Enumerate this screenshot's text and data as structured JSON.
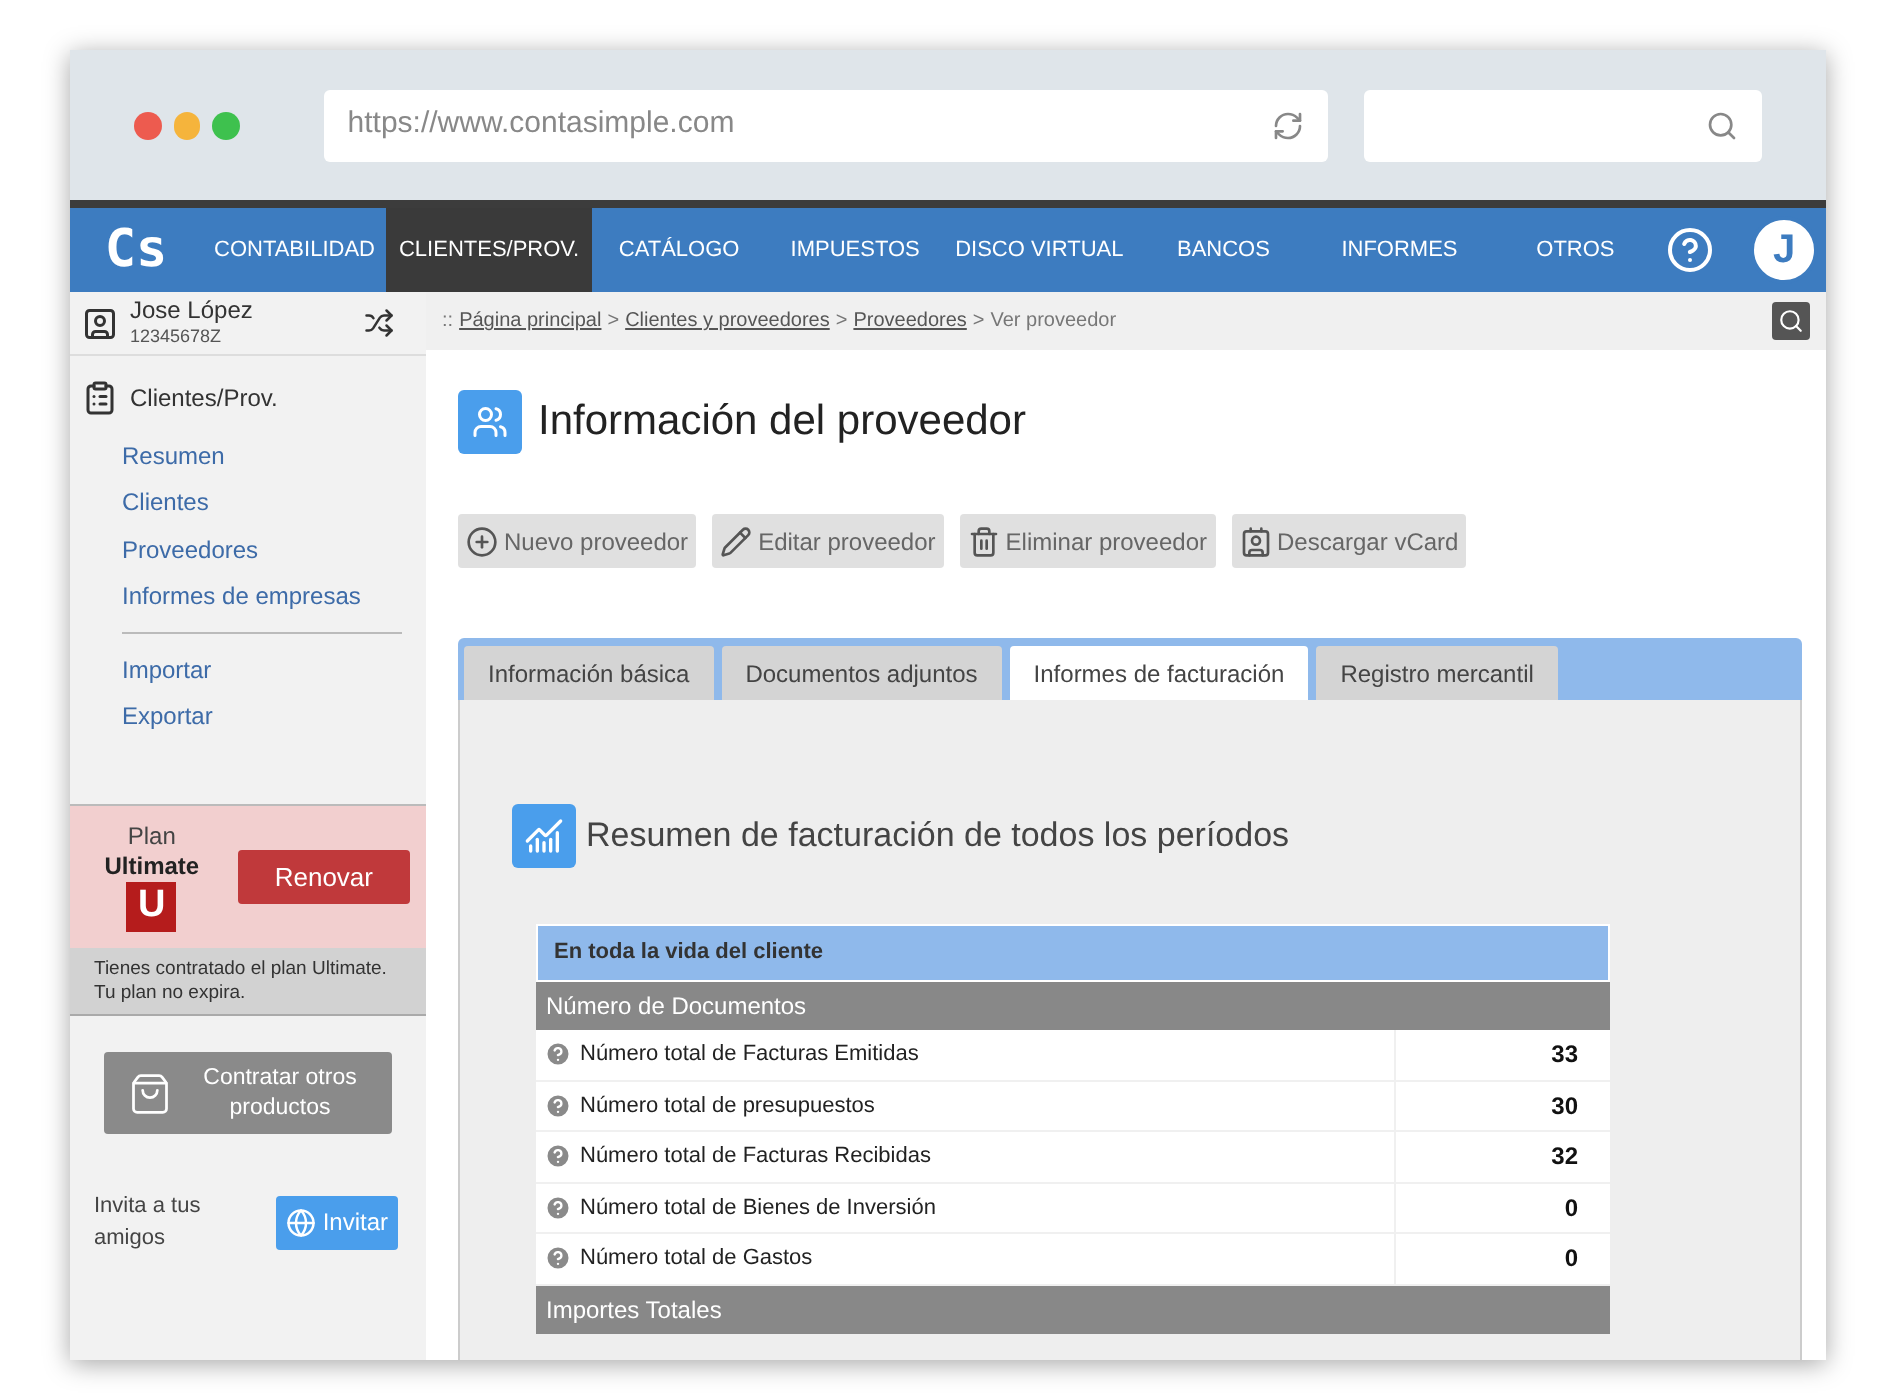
{
  "browser": {
    "url": "https://www.contasimple.com"
  },
  "nav": {
    "logo": "Cs",
    "items": [
      {
        "label": "CONTABILIDAD",
        "selected": false
      },
      {
        "label": "CLIENTES/PROV.",
        "selected": true
      },
      {
        "label": "CATÁLOGO",
        "selected": false
      },
      {
        "label": "IMPUESTOS",
        "selected": false
      },
      {
        "label": "DISCO VIRTUAL",
        "selected": false
      },
      {
        "label": "BANCOS",
        "selected": false
      },
      {
        "label": "INFORMES",
        "selected": false
      },
      {
        "label": "OTROS",
        "selected": false
      }
    ],
    "avatar": "J"
  },
  "user": {
    "name": "Jose López",
    "id": "12345678Z"
  },
  "sidebar": {
    "title": "Clientes/Prov.",
    "groups": [
      [
        {
          "label": "Resumen"
        },
        {
          "label": "Clientes"
        },
        {
          "label": "Proveedores"
        },
        {
          "label": "Informes de empresas"
        }
      ],
      [
        {
          "label": "Importar"
        },
        {
          "label": "Exportar"
        }
      ]
    ]
  },
  "plan": {
    "label": "Plan",
    "name": "Ultimate",
    "badge": "U",
    "button": "Renovar",
    "note": "Tienes contratado el plan Ultimate. Tu plan no expira."
  },
  "products_button": "Contratar otros productos",
  "invite": {
    "text": "Invita a tus amigos",
    "button": "Invitar"
  },
  "breadcrumb": [
    {
      "kind": "prefix",
      "label": "::"
    },
    {
      "kind": "link",
      "label": "Página principal"
    },
    {
      "kind": "separator",
      "label": ">"
    },
    {
      "kind": "link",
      "label": "Clientes y proveedores"
    },
    {
      "kind": "separator",
      "label": ">"
    },
    {
      "kind": "link",
      "label": "Proveedores"
    },
    {
      "kind": "separator",
      "label": ">"
    },
    {
      "kind": "current",
      "label": "Ver proveedor"
    }
  ],
  "page": {
    "title": "Información del proveedor",
    "actions": [
      {
        "label": "Nuevo proveedor"
      },
      {
        "label": "Editar proveedor"
      },
      {
        "label": "Eliminar proveedor"
      },
      {
        "label": "Descargar vCard"
      }
    ],
    "tabs": [
      {
        "label": "Información básica",
        "selected": false
      },
      {
        "label": "Documentos adjuntos",
        "selected": false
      },
      {
        "label": "Informes de facturación",
        "selected": true
      },
      {
        "label": "Registro mercantil",
        "selected": false
      }
    ],
    "section_title": "Resumen de facturación de todos los períodos",
    "table": {
      "header": "En toda la vida del cliente",
      "groups": [
        {
          "title": "Número de Documentos",
          "rows": [
            {
              "label": "Número total de Facturas Emitidas",
              "value": "33"
            },
            {
              "label": "Número total de presupuestos",
              "value": "30"
            },
            {
              "label": "Número total de Facturas Recibidas",
              "value": "32"
            },
            {
              "label": "Número total de Bienes de Inversión",
              "value": "0"
            },
            {
              "label": "Número total de Gastos",
              "value": "0"
            }
          ]
        },
        {
          "title": "Importes Totales"
        }
      ]
    }
  }
}
